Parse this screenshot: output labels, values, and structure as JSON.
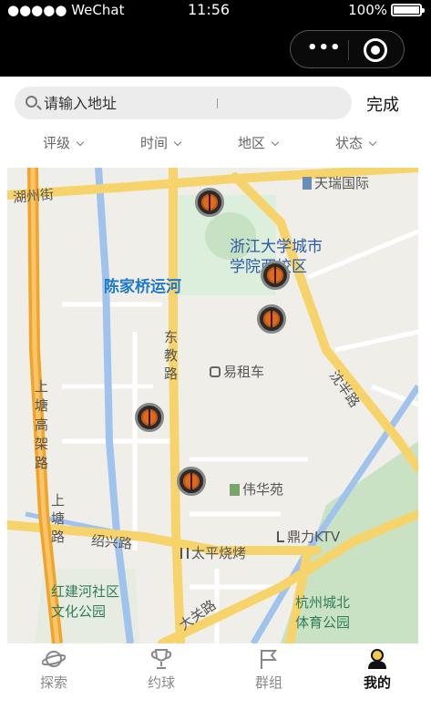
{
  "status_bar": {
    "carrier": "●●●●● WeChat",
    "time": "11:56",
    "battery": "100%"
  },
  "search": {
    "placeholder": "请输入地址",
    "done_label": "完成"
  },
  "filters": [
    {
      "label": "评级"
    },
    {
      "label": "时间"
    },
    {
      "label": "地区"
    },
    {
      "label": "状态"
    }
  ],
  "map": {
    "labels": {
      "hushu_street": "湖州街",
      "tianrui": "天瑞国际",
      "zju_campus": "浙江大学城市学院西校区",
      "zju_line1": "浙江大学城市",
      "zju_line2": "学院西校区",
      "canal": "陈家桥运河",
      "dongjiao_road": "东教路",
      "taxi": "易租车",
      "shangtang_viaduct": "上塘高架路",
      "shenban_road": "沈半路",
      "weihuayuan": "伟华苑",
      "dingli_ktv": "鼎力KTV",
      "shangtang_road": "上塘路",
      "shaoxing_road": "绍兴路",
      "taiping_bbq": "太平烧烤",
      "hongjianhe_park": "红建河社区文化公园",
      "hongjianhe_line1": "红建河社区",
      "hongjianhe_line2": "文化公园",
      "datong_road": "大关路",
      "hz_north_park": "杭州城北体育公园",
      "hz_north_line1": "杭州城北",
      "hz_north_line2": "体育公园"
    },
    "markers": [
      {
        "icon": "basketball-court-marker"
      },
      {
        "icon": "basketball-court-marker"
      },
      {
        "icon": "basketball-court-marker"
      },
      {
        "icon": "basketball-court-marker"
      },
      {
        "icon": "basketball-court-marker"
      }
    ]
  },
  "tabs": [
    {
      "label": "探索",
      "icon": "planet-icon"
    },
    {
      "label": "约球",
      "icon": "trophy-icon"
    },
    {
      "label": "群组",
      "icon": "flag-icon"
    },
    {
      "label": "我的",
      "icon": "user-icon"
    }
  ],
  "colors": {
    "road_major": "#f7d36b",
    "road_viaduct": "#f0a52a",
    "water": "#9fc3ec",
    "park": "#c8e1c2",
    "campus": "#d9ecd8"
  }
}
